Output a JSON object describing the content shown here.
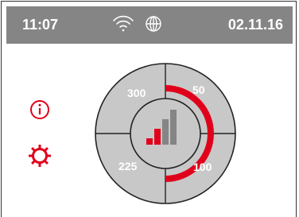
{
  "status_bar": {
    "time": "11:07",
    "date": "02.11.16",
    "wifi_icon": "wifi-icon",
    "globe_icon": "globe-icon"
  },
  "side_menu": {
    "info_icon": "info-icon",
    "settings_icon": "gear-icon"
  },
  "dial": {
    "segments": {
      "top_left": "300",
      "top_right": "50",
      "bottom_right": "100",
      "bottom_left": "225"
    },
    "center_icon": "signal-strength-icon",
    "active_arc": "right-half",
    "colors": {
      "accent": "#e0001b",
      "segment_fill": "#c8c8c8",
      "bar_gray": "#858585"
    }
  }
}
